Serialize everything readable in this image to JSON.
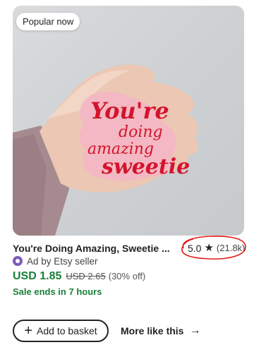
{
  "listing": {
    "badge": "Popular now",
    "sticker_text": [
      "You're",
      "doing",
      "amazing",
      "sweetie"
    ],
    "title": "You're Doing Amazing, Sweetie ...",
    "rating": {
      "score": "5.0",
      "star": "★",
      "count": "(21.8k)",
      "stars_value": 5.0
    },
    "ad_label": "Ad by Etsy seller",
    "price": "USD 1.85",
    "original_price": "USD 2.65",
    "discount": "(30% off)",
    "sale_note": "Sale ends in 7 hours"
  },
  "actions": {
    "add_to_basket": "Add to basket",
    "add_icon": "+",
    "more_like_this": "More like this",
    "more_icon": "→"
  },
  "colors": {
    "price_green": "#1a7f37",
    "annotation_red": "#e31b1b",
    "ad_purple": "#7b5bb8",
    "sticker_pink": "#f3b8c3",
    "sticker_red": "#d3142c"
  },
  "icons": {
    "ad": "etsy-ad-badge-icon",
    "star": "star-icon",
    "plus": "plus-icon",
    "arrow": "arrow-right-icon"
  }
}
